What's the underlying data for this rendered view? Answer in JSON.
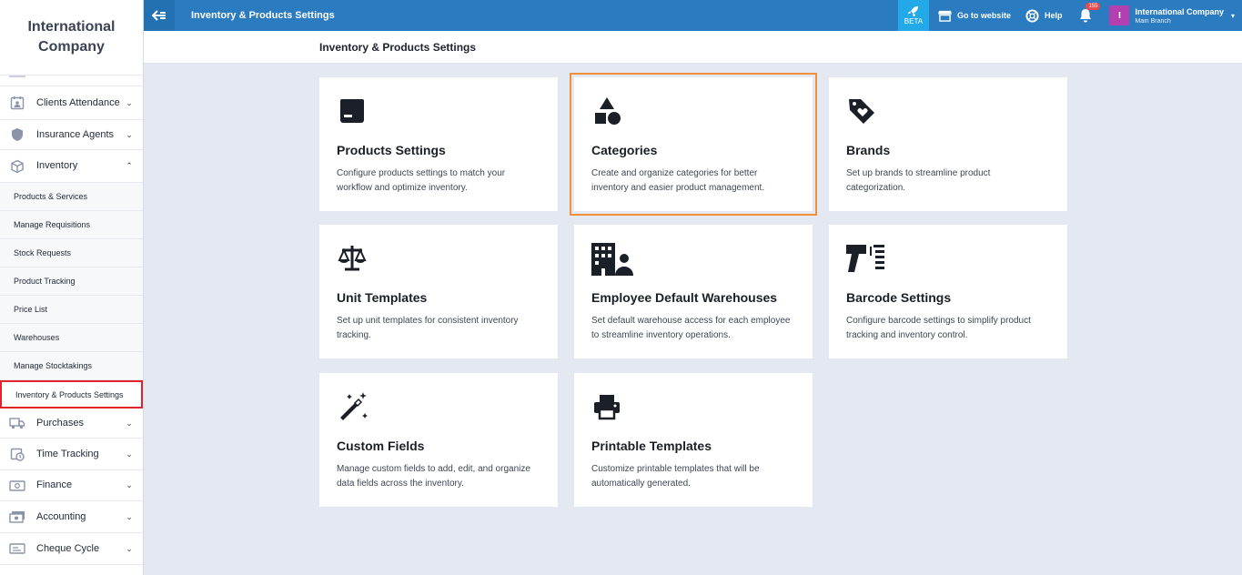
{
  "sidebar": {
    "brand": "International Company",
    "items_top": [
      {
        "label": "Clients Attendance",
        "icon": "calendar-user-icon"
      },
      {
        "label": "Insurance Agents",
        "icon": "shield-icon"
      },
      {
        "label": "Inventory",
        "icon": "box-icon"
      }
    ],
    "sub_items": [
      "Products & Services",
      "Manage Requisitions",
      "Stock Requests",
      "Product Tracking",
      "Price List",
      "Warehouses",
      "Manage Stocktakings",
      "Inventory & Products Settings"
    ],
    "items_bottom": [
      {
        "label": "Purchases",
        "icon": "truck-icon"
      },
      {
        "label": "Time Tracking",
        "icon": "clock-calendar-icon"
      },
      {
        "label": "Finance",
        "icon": "cash-icon"
      },
      {
        "label": "Accounting",
        "icon": "money-icon"
      },
      {
        "label": "Cheque Cycle",
        "icon": "cheque-icon"
      }
    ]
  },
  "topbar": {
    "title": "Inventory & Products Settings",
    "beta_label": "BETA",
    "go_to_website": "Go to website",
    "help": "Help",
    "notification_count": "155",
    "account_initial": "I",
    "account_name": "International Company",
    "account_branch": "Main Branch"
  },
  "page": {
    "title": "Inventory & Products Settings"
  },
  "cards": [
    {
      "title": "Products Settings",
      "desc": "Configure products settings to match your workflow and optimize inventory.",
      "icon": "product-box-icon"
    },
    {
      "title": "Categories",
      "desc": "Create and organize categories for better inventory and easier product management.",
      "icon": "shapes-icon"
    },
    {
      "title": "Brands",
      "desc": "Set up brands to streamline product categorization.",
      "icon": "tag-heart-icon"
    },
    {
      "title": "Unit Templates",
      "desc": "Set up unit templates for consistent inventory tracking.",
      "icon": "scale-icon"
    },
    {
      "title": "Employee Default Warehouses",
      "desc": "Set default warehouse access for each employee to streamline inventory operations.",
      "icon": "building-user-icon"
    },
    {
      "title": "Barcode Settings",
      "desc": "Configure barcode settings to simplify product tracking and inventory control.",
      "icon": "barcode-scanner-icon"
    },
    {
      "title": "Custom Fields",
      "desc": "Manage custom fields to add, edit, and organize data fields across the inventory.",
      "icon": "magic-wand-icon"
    },
    {
      "title": "Printable Templates",
      "desc": "Customize printable templates that will be automatically generated.",
      "icon": "printer-icon"
    }
  ],
  "colors": {
    "topbar": "#2a7bc0",
    "beta": "#23a9e8",
    "active_outline": "#e0242e",
    "highlight_outline": "#f28f3b",
    "avatar": "#b43fb0"
  }
}
